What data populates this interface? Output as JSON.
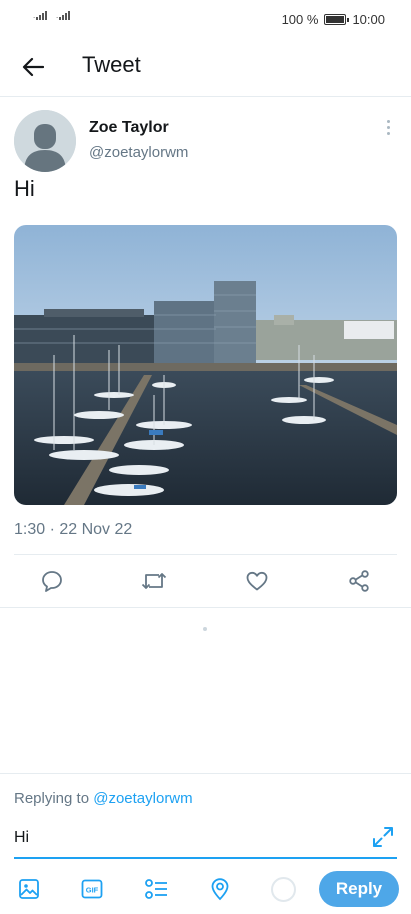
{
  "status_bar": {
    "battery_percent": "100 %",
    "time": "10:00",
    "battery_level": 1.0
  },
  "header": {
    "title": "Tweet",
    "back_icon": "arrow-left-icon"
  },
  "tweet": {
    "author_name": "Zoe Taylor",
    "author_handle": "@zoetaylorwm",
    "text": "Hi",
    "timestamp": "1:30 · 22 Nov 22",
    "media": "marina-photo"
  },
  "actions": [
    {
      "name": "reply-action",
      "icon": "comment-icon"
    },
    {
      "name": "retweet-action",
      "icon": "retweet-icon"
    },
    {
      "name": "like-action",
      "icon": "heart-icon"
    },
    {
      "name": "share-action",
      "icon": "share-icon"
    }
  ],
  "reply": {
    "replying_prefix": "Replying to ",
    "replying_handle": "@zoetaylorwm",
    "input_value": "Hi",
    "reply_button": "Reply"
  },
  "toolbar": [
    {
      "name": "image-button",
      "icon": "image-icon"
    },
    {
      "name": "gif-button",
      "icon": "gif-icon",
      "label": "GIF"
    },
    {
      "name": "poll-button",
      "icon": "poll-icon"
    },
    {
      "name": "location-button",
      "icon": "location-pin-icon"
    }
  ],
  "colors": {
    "accent": "#1da1f2",
    "reply_button": "#4ea7e8",
    "secondary_text": "#657786"
  }
}
